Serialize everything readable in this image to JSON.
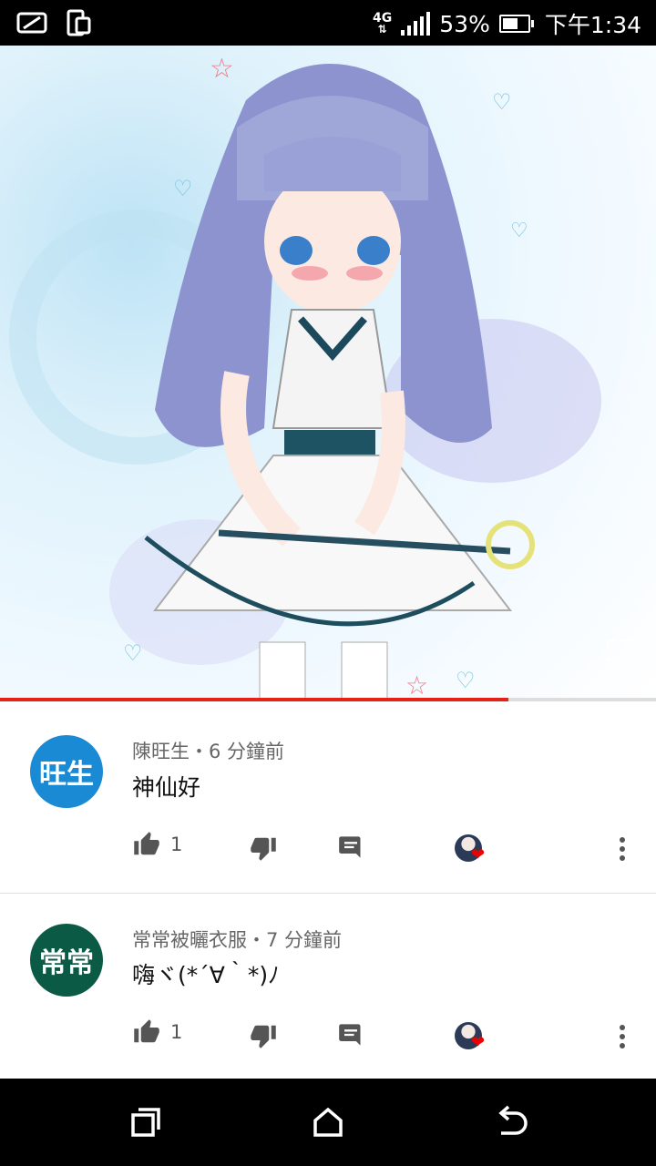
{
  "status_bar": {
    "network": "4G",
    "battery_percent": "53%",
    "time": "下午1:34",
    "icons": [
      "notification-app-icon",
      "screen-rotate-icon"
    ]
  },
  "video": {
    "description_icon": "anime-girl-illustration",
    "progress": 0.775
  },
  "comments": [
    {
      "avatar_text": "旺生",
      "avatar_color": "#1a8ad4",
      "author": "陳旺生",
      "time_ago": "6 分鐘前",
      "meta": "陳旺生・6 分鐘前",
      "text": "神仙好",
      "likes": "1"
    },
    {
      "avatar_text": "常常",
      "avatar_color": "#0b5a45",
      "author": "常常被曬衣服",
      "time_ago": "7 分鐘前",
      "meta": "常常被曬衣服・7 分鐘前",
      "text": "嗨ヾ(*´∀｀*)ﾉ",
      "likes": "1"
    }
  ],
  "nav": {
    "icons": [
      "recent-apps-icon",
      "home-icon",
      "back-icon"
    ]
  }
}
